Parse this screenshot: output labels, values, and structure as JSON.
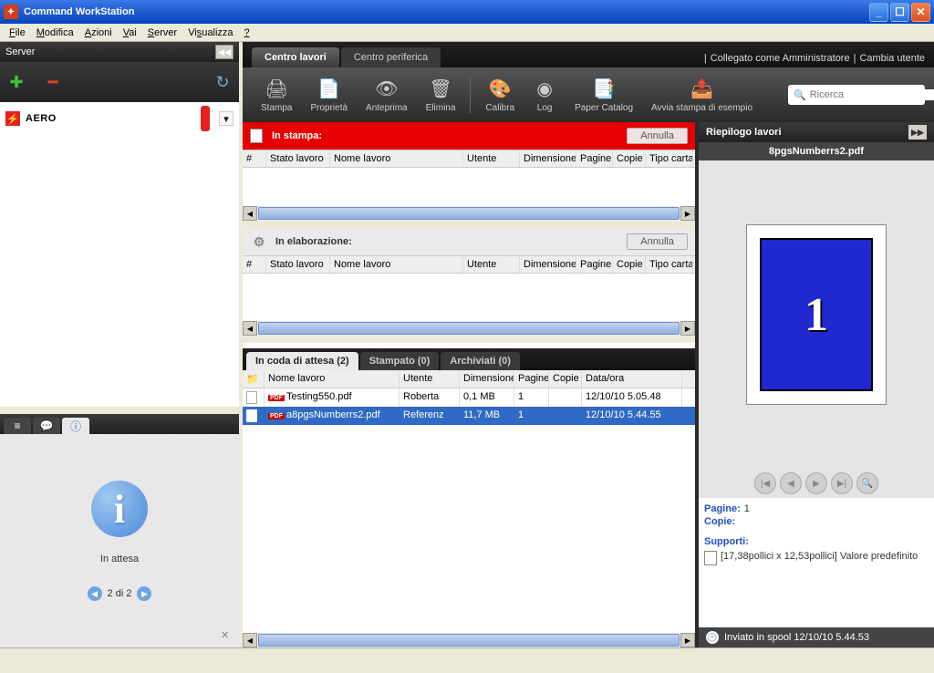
{
  "window": {
    "title": "Command WorkStation"
  },
  "menu": [
    "File",
    "Modifica",
    "Azioni",
    "Vai",
    "Server",
    "Visualizza",
    "?"
  ],
  "sidebar": {
    "header": "Server",
    "server_name": "AERO"
  },
  "bottom_left": {
    "state_label": "In attesa",
    "pager": "2 di 2"
  },
  "tabs": {
    "job_center": "Centro lavori",
    "device_center": "Centro periferica",
    "logged_as": "Collegato come Amministratore",
    "switch_user": "Cambia utente"
  },
  "toolbar": {
    "print": "Stampa",
    "properties": "Proprietà",
    "preview": "Anteprima",
    "delete": "Elimina",
    "calibrate": "Calibra",
    "log": "Log",
    "paper_catalog": "Paper Catalog",
    "sample_print": "Avvia stampa di esempio",
    "search_placeholder": "Ricerca"
  },
  "sections": {
    "printing": "In stampa:",
    "processing": "In elaborazione:",
    "cancel": "Annulla",
    "columns": {
      "num": "#",
      "stato": "Stato lavoro",
      "nome": "Nome lavoro",
      "utente": "Utente",
      "dim": "Dimensione",
      "pagine": "Pagine",
      "copie": "Copie",
      "tipo": "Tipo carta"
    }
  },
  "queue_tabs": {
    "hold": "In coda di attesa (2)",
    "printed": "Stampato (0)",
    "archived": "Archiviati (0)"
  },
  "queue_columns": {
    "nome": "Nome lavoro",
    "utente": "Utente",
    "dim": "Dimensione",
    "pagine": "Pagine",
    "copie": "Copie",
    "data": "Data/ora"
  },
  "jobs": [
    {
      "icon": "pdf",
      "name": "Testing550.pdf",
      "user": "Roberta",
      "size": "0,1 MB",
      "pages": "1",
      "copies": "",
      "date": "12/10/10 5.05.48"
    },
    {
      "icon": "pdf",
      "name": "a8pgsNumberrs2.pdf",
      "user": "Referenz",
      "size": "11,7 MB",
      "pages": "1",
      "copies": "",
      "date": "12/10/10 5.44.55"
    }
  ],
  "summary": {
    "title": "Riepilogo lavori",
    "filename": "8pgsNumberrs2.pdf",
    "page_number": "1",
    "pages_label": "Pagine:",
    "pages_val": "1",
    "copies_label": "Copie:",
    "supports_label": "Supporti:",
    "supports_line": "[17,38pollici x 12,53pollici]  Valore predefinito",
    "spool": "Inviato in spool 12/10/10 5.44.53"
  }
}
